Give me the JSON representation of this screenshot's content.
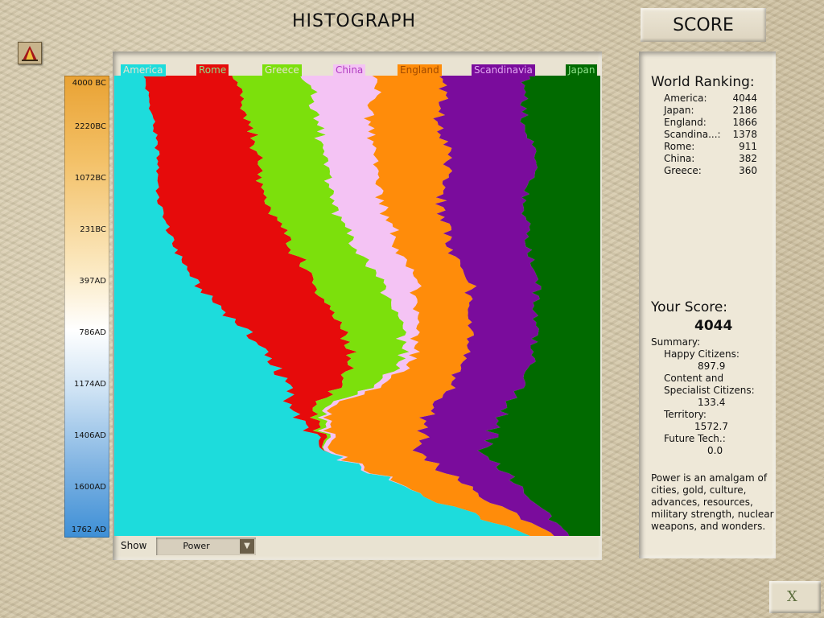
{
  "header": {
    "title": "HISTOGRAPH",
    "score_tab": "SCORE"
  },
  "advisor_icon": "civ-advisor-icon",
  "timeline": [
    "4000 BC",
    "2220BC",
    "1072BC",
    "231BC",
    "397AD",
    "786AD",
    "1174AD",
    "1406AD",
    "1600AD",
    "1762 AD"
  ],
  "controls": {
    "show_label": "Show",
    "show_value": "Power",
    "dropdown_icon": "triangle-down-icon"
  },
  "chart_data": {
    "type": "area",
    "title": "",
    "stacking": "stacked",
    "orientation": "vertical-time-axis",
    "x_label": "",
    "y_label": "",
    "time_ticks": [
      "4000 BC",
      "2220BC",
      "1072BC",
      "231BC",
      "397AD",
      "786AD",
      "1174AD",
      "1406AD",
      "1600AD",
      "1762 AD"
    ],
    "series": [
      {
        "name": "America",
        "color": "#1ddcdc",
        "values": [
          0.06,
          0.08,
          0.09,
          0.09,
          0.12,
          0.17,
          0.27,
          0.34,
          0.37,
          0.43,
          0.63,
          0.86
        ]
      },
      {
        "name": "Rome",
        "color": "#e60b0b",
        "values": [
          0.19,
          0.19,
          0.21,
          0.22,
          0.24,
          0.24,
          0.21,
          0.15,
          0.04,
          0.0,
          0.0,
          0.0
        ]
      },
      {
        "name": "Greece",
        "color": "#7ce00c",
        "values": [
          0.14,
          0.15,
          0.14,
          0.14,
          0.13,
          0.14,
          0.13,
          0.1,
          0.02,
          0.0,
          0.0,
          0.0
        ]
      },
      {
        "name": "China",
        "color": "#f4c3f4",
        "values": [
          0.15,
          0.11,
          0.1,
          0.1,
          0.09,
          0.07,
          0.03,
          0.02,
          0.01,
          0.01,
          0.0,
          0.0
        ]
      },
      {
        "name": "England",
        "color": "#ff8c0a",
        "values": [
          0.14,
          0.14,
          0.15,
          0.12,
          0.11,
          0.11,
          0.11,
          0.11,
          0.21,
          0.18,
          0.12,
          0.05
        ]
      },
      {
        "name": "Scandinavia",
        "color": "#7a0c9c",
        "values": [
          0.17,
          0.17,
          0.18,
          0.17,
          0.16,
          0.14,
          0.14,
          0.14,
          0.15,
          0.14,
          0.1,
          0.03
        ]
      },
      {
        "name": "Japan",
        "color": "#016a00",
        "values": [
          0.15,
          0.16,
          0.13,
          0.16,
          0.15,
          0.13,
          0.14,
          0.14,
          0.2,
          0.24,
          0.15,
          0.06
        ]
      }
    ]
  },
  "ranking": {
    "title": "World Ranking:",
    "rows": [
      {
        "name": "America:",
        "score": "4044"
      },
      {
        "name": "Japan:",
        "score": "2186"
      },
      {
        "name": "England:",
        "score": "1866"
      },
      {
        "name": "Scandina...:",
        "score": "1378"
      },
      {
        "name": "Rome:",
        "score": "911"
      },
      {
        "name": "China:",
        "score": "382"
      },
      {
        "name": "Greece:",
        "score": "360"
      }
    ]
  },
  "your_score": {
    "title": "Your Score:",
    "value": "4044",
    "summary_label": "Summary:",
    "happy_label": "Happy Citizens:",
    "happy_value": "897.9",
    "content_label_1": "Content and",
    "content_label_2": "Specialist Citizens:",
    "content_value": "133.4",
    "territory_label": "Territory:",
    "territory_value": "1572.7",
    "future_label": "Future Tech.:",
    "future_value": "0.0"
  },
  "description": [
    "Power is an amalgam of",
    "cities, gold, culture,",
    "advances, resources,",
    "military strength, nuclear",
    "weapons, and wonders."
  ],
  "exit_button": {
    "label": "X"
  }
}
